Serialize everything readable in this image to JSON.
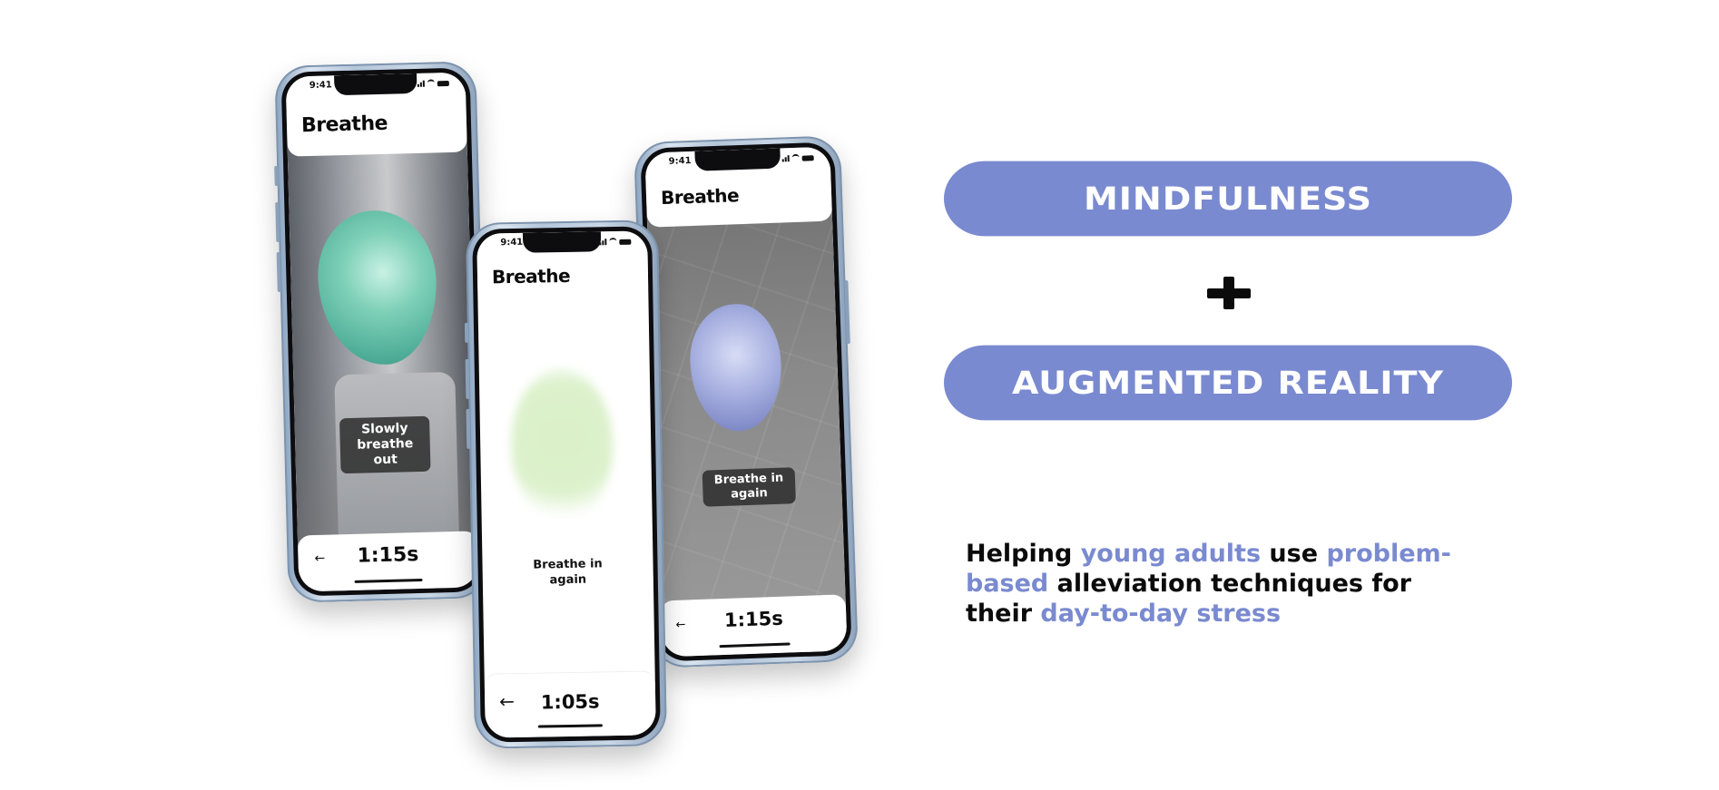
{
  "phones": {
    "left": {
      "status_time": "9:41",
      "app_title": "Breathe",
      "caption": "Slowly breathe out",
      "timer": "1:15s",
      "back_icon": "back-arrow-icon",
      "back_glyph": "←"
    },
    "middle": {
      "status_time": "9:41",
      "app_title": "Breathe",
      "caption": "Breathe in again",
      "timer": "1:05s",
      "back_icon": "back-arrow-icon",
      "back_glyph": "←"
    },
    "right": {
      "status_time": "9:41",
      "app_title": "Breathe",
      "caption": "Breathe in again",
      "timer": "1:15s",
      "back_icon": "back-arrow-icon",
      "back_glyph": "←"
    }
  },
  "pills": {
    "first": "MINDFULNESS",
    "second": "AUGMENTED REALITY"
  },
  "tagline": {
    "part1": "Helping ",
    "hl1": "young adults",
    "part2": " use ",
    "hl2": "problem-based",
    "part3": " alleviation techniques for their ",
    "hl3": "day-to-day stress"
  },
  "colors": {
    "accent": "#7a8ad0",
    "text": "#0b0b0b",
    "background": "#ffffff"
  }
}
